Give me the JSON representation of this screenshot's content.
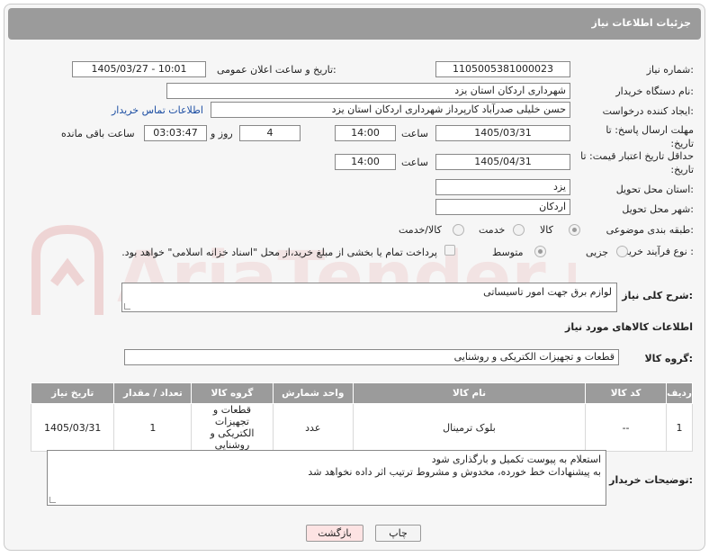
{
  "header": {
    "title": "جزئیات اطلاعات نیاز"
  },
  "fields": {
    "need_number_label": "شماره نیاز:",
    "need_number": "1105005381000023",
    "announce_label": "تاریخ و ساعت اعلان عمومی:",
    "announce_value": "1405/03/27 - 10:01",
    "buyer_org_label": "نام دستگاه خریدار:",
    "buyer_org": "شهرداری اردکان استان یزد",
    "creator_label": "ایجاد کننده درخواست:",
    "creator": "حسن خلیلی صدرآباد کارپرداز شهرداری اردکان استان یزد",
    "contact_link": "اطلاعات تماس خریدار",
    "deadline_label": "مهلت ارسال پاسخ: تا تاریخ:",
    "deadline_date": "1405/03/31",
    "time_label": "ساعت",
    "deadline_time": "14:00",
    "days_value": "4",
    "days_label": "روز و",
    "remaining_time": "03:03:47",
    "remaining_label": "ساعت باقی مانده",
    "price_validity_label": "حداقل تاریخ اعتبار قیمت: تا تاریخ:",
    "price_validity_date": "1405/04/31",
    "price_validity_time": "14:00",
    "province_label": "استان محل تحویل:",
    "province": "یزد",
    "city_label": "شهر محل تحویل:",
    "city": "اردکان",
    "category_label": "طبقه بندی موضوعی:",
    "category_options": [
      "کالا",
      "خدمت",
      "کالا/خدمت"
    ],
    "process_label": "نوع فرآیند خرید :",
    "process_options": [
      "جزیی",
      "متوسط"
    ],
    "payment_note": "پرداخت تمام یا بخشی از مبلغ خرید،از محل \"اسناد خزانه اسلامی\" خواهد بود."
  },
  "description": {
    "label": "شرح کلی نیاز:",
    "value": "لوازم برق جهت امور تاسیساتی"
  },
  "goods_section": {
    "title": "اطلاعات کالاهای مورد نیاز"
  },
  "goods_group": {
    "label": "گروه کالا:",
    "value": "قطعات و تجهیزات الکتریکی و روشنایی"
  },
  "table": {
    "headers": [
      "ردیف",
      "کد کالا",
      "نام کالا",
      "واحد شمارش",
      "گروه کالا",
      "تعداد / مقدار",
      "تاریخ نیاز"
    ],
    "rows": [
      [
        "1",
        "--",
        "بلوک ترمینال",
        "عدد",
        "قطعات و تجهیزات الکتریکی و روشنایی",
        "1",
        "1405/03/31"
      ]
    ]
  },
  "buyer_notes": {
    "label": "توضیحات خریدار:",
    "line1": "استعلام به پیوست تکمیل و بارگذاری شود",
    "line2": "به پیشنهادات خط خورده، مخدوش و مشروط ترتیب اثر داده نخواهد شد"
  },
  "buttons": {
    "print": "چاپ",
    "back": "بازگشت"
  },
  "watermark": {
    "text": "AriaTender.net"
  },
  "colors": {
    "header_bg": "#9b9b9b",
    "link": "#1c4ea3",
    "back_button_bg": "#fde3e3"
  }
}
